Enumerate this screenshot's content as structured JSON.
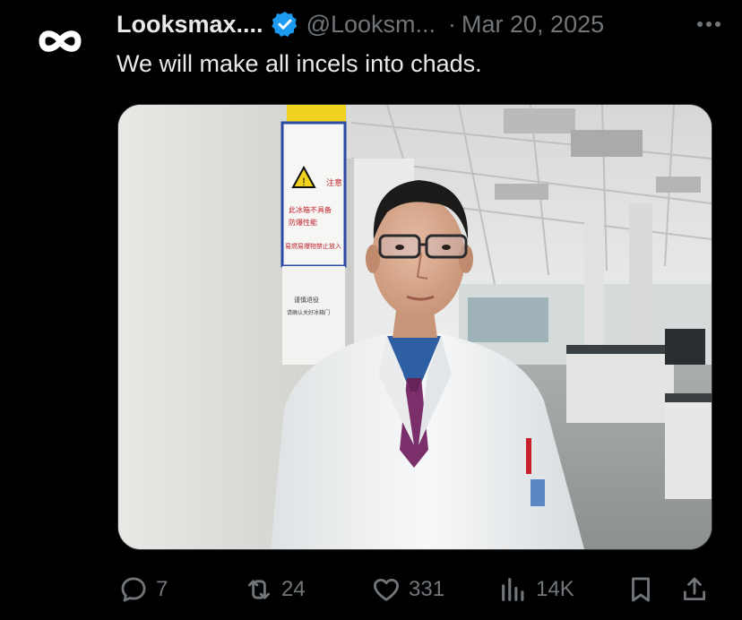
{
  "tweet": {
    "author_name": "Looksmax....",
    "handle": "@Looksm...",
    "separator": "·",
    "date": "Mar 20, 2025",
    "text": "We will make all incels into chads.",
    "avatar_icon": "infinity-logo-icon",
    "verified_icon": "verified-badge-icon"
  },
  "media": {
    "sign_text_top": "注意",
    "sign_text_lines": [
      "此冰箱不具备",
      "防爆性能",
      "易燃易爆物禁止放入"
    ],
    "paper_text": [
      "谨慎退役",
      "请确认关好冰箱门"
    ]
  },
  "actions": {
    "reply": {
      "icon": "reply-icon",
      "count": "7"
    },
    "retweet": {
      "icon": "retweet-icon",
      "count": "24"
    },
    "like": {
      "icon": "heart-icon",
      "count": "331"
    },
    "views": {
      "icon": "views-chart-icon",
      "count": "14K"
    },
    "bookmark": {
      "icon": "bookmark-icon"
    },
    "share": {
      "icon": "share-icon"
    }
  },
  "colors": {
    "background": "#000000",
    "text_primary": "#e7e9ea",
    "text_secondary": "#71767b",
    "verified_blue": "#1d9bf0"
  }
}
